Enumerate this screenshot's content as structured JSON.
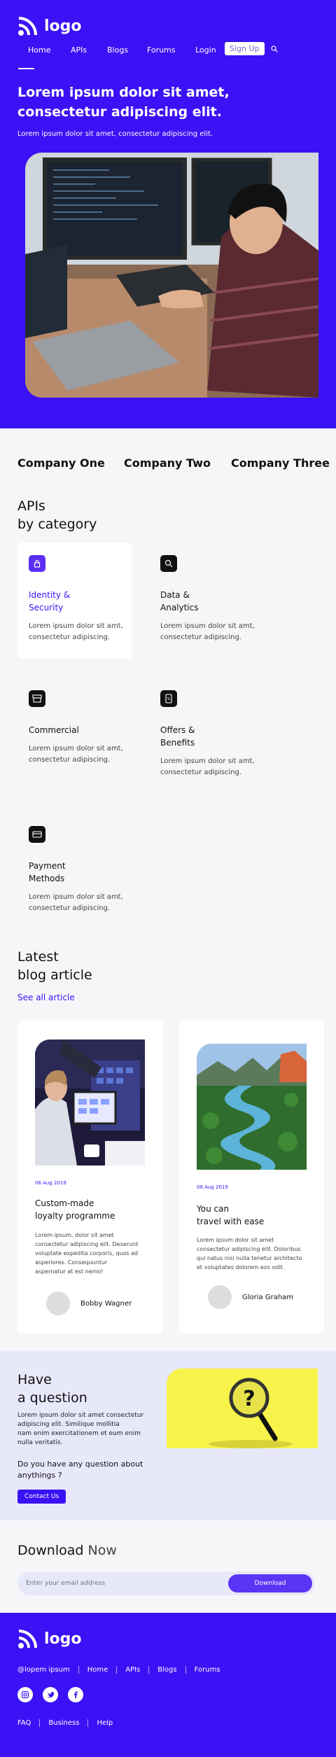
{
  "brand": {
    "logo_text": "logo"
  },
  "nav": {
    "items": [
      "Home",
      "APIs",
      "Blogs",
      "Forums",
      "Login"
    ],
    "signup": "Sign Up"
  },
  "hero": {
    "title": "Lorem ipsum dolor sit amet, consectetur adipiscing elit.",
    "subtitle": "Lorem ipsum dolor sit amet, consectetur adipiscing elit."
  },
  "companies": [
    "Company One",
    "Company Two",
    "Company Three"
  ],
  "apis": {
    "title_line1": "APIs",
    "title_line2": "by category",
    "categories": [
      {
        "name_line1": "Identity &",
        "name_line2": "Security",
        "desc_line1": "Lorem ipsum dolor sit amt,",
        "desc_line2": "consectetur adipiscing.",
        "icon": "lock-icon"
      },
      {
        "name_line1": "Data &",
        "name_line2": "Analytics",
        "desc_line1": "Lorem ipsum dolor sit amt,",
        "desc_line2": "consectetur adipiscing.",
        "icon": "analytics-icon"
      },
      {
        "name_line1": "Commercial",
        "name_line2": "",
        "desc_line1": "Lorem ipsum dolor sit amt,",
        "desc_line2": "consectetur adipiscing.",
        "icon": "store-icon"
      },
      {
        "name_line1": "Offers &",
        "name_line2": "Benefits",
        "desc_line1": "Lorem ipsum dolor sit amt,",
        "desc_line2": "consectetur adipiscing.",
        "icon": "phone-offer-icon"
      },
      {
        "name_line1": "Payment",
        "name_line2": "Methods",
        "desc_line1": "Lorem ipsum dolor sit amt,",
        "desc_line2": "consectetur adipiscing.",
        "icon": "card-icon"
      }
    ]
  },
  "blog": {
    "title_line1": "Latest",
    "title_line2": "blog article",
    "see_all": "See all article",
    "posts": [
      {
        "date": "06 Aug 2019",
        "title_line1": "Custom-made",
        "title_line2": "loyalty programme",
        "text": [
          "Lorem ipsum, dolor sit amet",
          "consectetur adipiscing elit. Deserunt",
          "voluptate expedita corporis, quos ad",
          "asperiores. Consequuntur",
          "aspernatur at est nemo!"
        ],
        "author": "Bobby Wagner"
      },
      {
        "date": "08 Aug 2019",
        "title_line1": "You can",
        "title_line2": "travel with ease",
        "text": [
          "Lorem ipsum dolor sit amet",
          "consectetur adipiscing elit. Doloribus",
          "qui natus nisi nulla tenetur architecto",
          "et voluptates dolorem eos odit."
        ],
        "author": "Gloria Graham"
      }
    ]
  },
  "question": {
    "title_line1": "Have",
    "title_line2": "a question",
    "text": [
      "Lorem ipsum dolor sit amet consectetur",
      "adipiscing elit. Similique mollitia",
      "nam enim exercitationem et eum enim",
      "nulla veritatis."
    ],
    "prompt_line1": "Do you have any question about",
    "prompt_line2": "anythings ?",
    "button": "Contact Us"
  },
  "download": {
    "title_bold": "Download",
    "title_light": "Now",
    "placeholder": "Enter your email address",
    "button": "Download"
  },
  "footer": {
    "logo_text": "logo",
    "links": [
      "@lopem ipsum",
      "Home",
      "APIs",
      "Blogs",
      "Forums"
    ],
    "bottom_links": [
      "FAQ",
      "Business",
      "Help"
    ]
  },
  "colors": {
    "primary": "#3b12f5",
    "accent_yellow": "#f7f34a",
    "light_lavender": "#e8e8fb"
  }
}
